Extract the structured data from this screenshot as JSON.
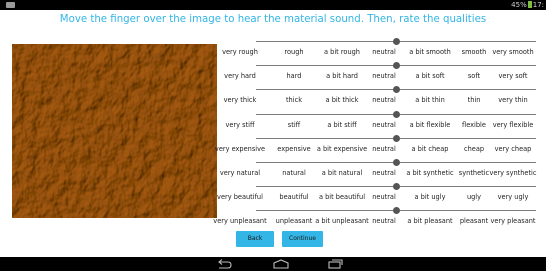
{
  "status_bar": {
    "battery_text": "45%",
    "time": "17:"
  },
  "instruction": "Move the finger over the image to hear the material sound. Then, rate the qualities",
  "scale_labels": [
    [
      "very rough",
      "rough",
      "a bit rough",
      "neutral",
      "a bit smooth",
      "smooth",
      "very smooth"
    ],
    [
      "very hard",
      "hard",
      "a bit hard",
      "neutral",
      "a bit soft",
      "soft",
      "very soft"
    ],
    [
      "very thick",
      "thick",
      "a bit thick",
      "neutral",
      "a bit thin",
      "thin",
      "very thin"
    ],
    [
      "very stiff",
      "stiff",
      "a bit stiff",
      "neutral",
      "a bit flexible",
      "flexible",
      "very flexible"
    ],
    [
      "very expensive",
      "expensive",
      "a bit expensive",
      "neutral",
      "a bit cheap",
      "cheap",
      "very cheap"
    ],
    [
      "very natural",
      "natural",
      "a bit natural",
      "neutral",
      "a bit synthetic",
      "synthetic",
      "very synthetic"
    ],
    [
      "very beautiful",
      "beautiful",
      "a bit beautiful",
      "neutral",
      "a bit ugly",
      "ugly",
      "very ugly"
    ],
    [
      "very unpleasant",
      "unpleasant",
      "a bit unpleasant",
      "neutral",
      "a bit pleasant",
      "pleasant",
      "very pleasant"
    ]
  ],
  "slider_values": [
    3,
    3,
    3,
    3,
    3,
    3,
    3,
    3
  ],
  "slider_max": 6,
  "buttons": {
    "back": "Back",
    "continue": "Continue"
  },
  "colors": {
    "accent": "#33b5e5",
    "leather": "#b98330"
  },
  "icons": {
    "nav_back": "back-arrow-icon",
    "nav_home": "home-icon",
    "nav_recents": "recent-apps-icon"
  }
}
